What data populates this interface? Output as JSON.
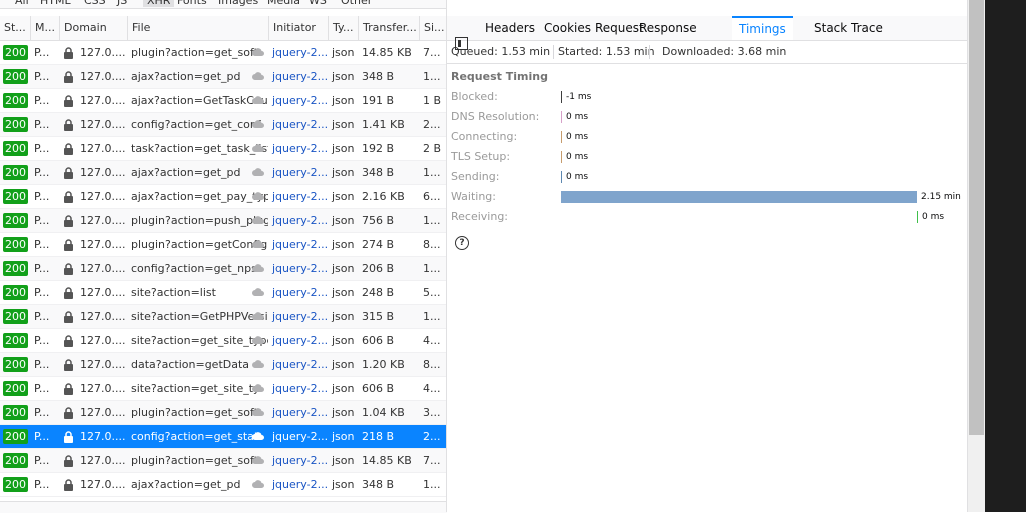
{
  "filters": [
    "All",
    "HTML",
    "CSS",
    "JS",
    "XHR",
    "Fonts",
    "Images",
    "Media",
    "WS",
    "Other"
  ],
  "selected_filter": "XHR",
  "columns": [
    "St...",
    "M...",
    "Domain",
    "File",
    "Initiator",
    "Ty...",
    "Transfer...",
    "Si..."
  ],
  "rows": [
    {
      "status": "200",
      "method": "P...",
      "domain": "127.0....",
      "file": "plugin?action=get_soft",
      "initiator": "jquery-2...",
      "type": "json",
      "transferred": "14.85 KB",
      "size": "7..."
    },
    {
      "status": "200",
      "method": "P...",
      "domain": "127.0....",
      "file": "ajax?action=get_pd",
      "initiator": "jquery-2...",
      "type": "json",
      "transferred": "348 B",
      "size": "1..."
    },
    {
      "status": "200",
      "method": "P...",
      "domain": "127.0....",
      "file": "ajax?action=GetTaskCount",
      "initiator": "jquery-2...",
      "type": "json",
      "transferred": "191 B",
      "size": "1 B"
    },
    {
      "status": "200",
      "method": "P...",
      "domain": "127.0....",
      "file": "config?action=get_conf",
      "initiator": "jquery-2...",
      "type": "json",
      "transferred": "1.41 KB",
      "size": "2..."
    },
    {
      "status": "200",
      "method": "P...",
      "domain": "127.0....",
      "file": "task?action=get_task_lists",
      "initiator": "jquery-2...",
      "type": "json",
      "transferred": "192 B",
      "size": "2 B"
    },
    {
      "status": "200",
      "method": "P...",
      "domain": "127.0....",
      "file": "ajax?action=get_pd",
      "initiator": "jquery-2...",
      "type": "json",
      "transferred": "348 B",
      "size": "1..."
    },
    {
      "status": "200",
      "method": "P...",
      "domain": "127.0....",
      "file": "ajax?action=get_pay_type",
      "initiator": "jquery-2...",
      "type": "json",
      "transferred": "2.16 KB",
      "size": "6..."
    },
    {
      "status": "200",
      "method": "P...",
      "domain": "127.0....",
      "file": "plugin?action=push_plugin",
      "initiator": "jquery-2...",
      "type": "json",
      "transferred": "756 B",
      "size": "1..."
    },
    {
      "status": "200",
      "method": "P...",
      "domain": "127.0....",
      "file": "plugin?action=getConfigHtm",
      "initiator": "jquery-2...",
      "type": "json",
      "transferred": "274 B",
      "size": "8..."
    },
    {
      "status": "200",
      "method": "P...",
      "domain": "127.0....",
      "file": "config?action=get_nps",
      "initiator": "jquery-2...",
      "type": "json",
      "transferred": "206 B",
      "size": "1..."
    },
    {
      "status": "200",
      "method": "P...",
      "domain": "127.0....",
      "file": "site?action=list",
      "initiator": "jquery-2...",
      "type": "json",
      "transferred": "248 B",
      "size": "5..."
    },
    {
      "status": "200",
      "method": "P...",
      "domain": "127.0....",
      "file": "site?action=GetPHPVersion",
      "initiator": "jquery-2...",
      "type": "json",
      "transferred": "315 B",
      "size": "1..."
    },
    {
      "status": "200",
      "method": "P...",
      "domain": "127.0....",
      "file": "site?action=get_site_types",
      "initiator": "jquery-2...",
      "type": "json",
      "transferred": "606 B",
      "size": "4..."
    },
    {
      "status": "200",
      "method": "P...",
      "domain": "127.0....",
      "file": "data?action=getData",
      "initiator": "jquery-2...",
      "type": "json",
      "transferred": "1.20 KB",
      "size": "8..."
    },
    {
      "status": "200",
      "method": "P...",
      "domain": "127.0....",
      "file": "site?action=get_site_ty",
      "initiator": "jquery-2...",
      "type": "json",
      "transferred": "606 B",
      "size": "4..."
    },
    {
      "status": "200",
      "method": "P...",
      "domain": "127.0....",
      "file": "plugin?action=get_soft",
      "initiator": "jquery-2...",
      "type": "json",
      "transferred": "1.04 KB",
      "size": "3..."
    },
    {
      "status": "200",
      "method": "P...",
      "domain": "127.0....",
      "file": "config?action=get_stat",
      "initiator": "jquery-2...",
      "type": "json",
      "transferred": "218 B",
      "size": "2...",
      "selected": true
    },
    {
      "status": "200",
      "method": "P...",
      "domain": "127.0....",
      "file": "plugin?action=get_soft",
      "initiator": "jquery-2...",
      "type": "json",
      "transferred": "14.85 KB",
      "size": "7..."
    },
    {
      "status": "200",
      "method": "P...",
      "domain": "127.0....",
      "file": "ajax?action=get_pd",
      "initiator": "jquery-2...",
      "type": "json",
      "transferred": "348 B",
      "size": "1..."
    }
  ],
  "tabs": [
    "Headers",
    "Cookies",
    "Request",
    "Response",
    "Timings",
    "Stack Trace"
  ],
  "active_tab": "Timings",
  "summary": {
    "queued": "Queued: 1.53 min",
    "started": "Started: 1.53 min",
    "downloaded": "Downloaded: 3.68 min"
  },
  "timing": {
    "title": "Request Timing",
    "rows": [
      {
        "label": "Blocked:",
        "value": "-1 ms",
        "fraction": 0.0,
        "color": "#3e3e3e"
      },
      {
        "label": "DNS Resolution:",
        "value": "0 ms",
        "fraction": 0.0,
        "color": "#d6a0c8"
      },
      {
        "label": "Connecting:",
        "value": "0 ms",
        "fraction": 0.0,
        "color": "#c69c6d"
      },
      {
        "label": "TLS Setup:",
        "value": "0 ms",
        "fraction": 0.0,
        "color": "#c69c6d"
      },
      {
        "label": "Sending:",
        "value": "0 ms",
        "fraction": 0.0,
        "color": "#5e88b0"
      },
      {
        "label": "Waiting:",
        "value": "2.15 min",
        "fraction": 1.0,
        "color": "#7fa4cc"
      },
      {
        "label": "Receiving:",
        "value": "0 ms",
        "fraction": 0.0,
        "color": "#3fbf4a"
      }
    ]
  },
  "help_icon": "?"
}
